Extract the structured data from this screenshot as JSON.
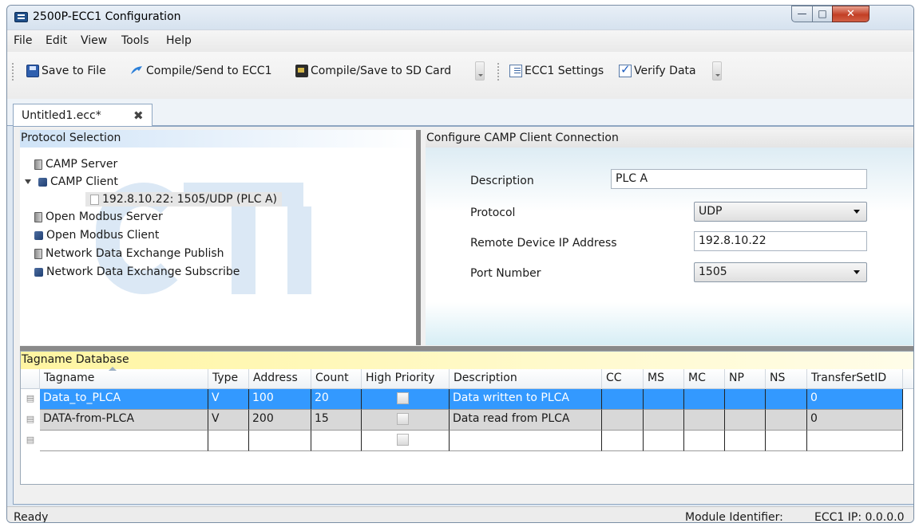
{
  "window": {
    "title": "2500P-ECC1 Configuration"
  },
  "menu": [
    "File",
    "Edit",
    "View",
    "Tools",
    "Help"
  ],
  "toolbar": {
    "save_file": "Save to File",
    "compile_send": "Compile/Send to ECC1",
    "compile_sd": "Compile/Save to SD Card",
    "ecc1_settings": "ECC1 Settings",
    "verify_data": "Verify Data"
  },
  "document_tab": {
    "label": "Untitled1.ecc*"
  },
  "protocol_pane": {
    "header": "Protocol Selection",
    "items": [
      "CAMP Server",
      "CAMP Client",
      "192.8.10.22: 1505/UDP (PLC A)",
      "Open Modbus Server",
      "Open Modbus Client",
      "Network Data Exchange Publish",
      "Network Data Exchange Subscribe"
    ]
  },
  "config_pane": {
    "header": "Configure CAMP Client Connection",
    "description_label": "Description",
    "description_value": "PLC A",
    "protocol_label": "Protocol",
    "protocol_value": "UDP",
    "ip_label": "Remote Device IP Address",
    "ip_value": "192.8.10.22",
    "port_label": "Port Number",
    "port_value": "1505"
  },
  "tag_db": {
    "header": "Tagname Database",
    "columns": [
      "Tagname",
      "Type",
      "Address",
      "Count",
      "High Priority",
      "Description",
      "CC",
      "MS",
      "MC",
      "NP",
      "NS",
      "TransferSetID"
    ],
    "rows": [
      [
        "Data_to_PLCA",
        "V",
        "100",
        "20",
        "",
        "Data written to PLCA",
        "",
        "",
        "",
        "",
        "",
        "0"
      ],
      [
        "DATA-from-PLCA",
        "V",
        "200",
        "15",
        "",
        "Data read from PLCA",
        "",
        "",
        "",
        "",
        "",
        "0"
      ],
      [
        "",
        "",
        "",
        "",
        "",
        "",
        "",
        "",
        "",
        "",
        "",
        ""
      ]
    ]
  },
  "status": {
    "left": "Ready",
    "module_label": "Module Identifier:",
    "ip_label": "ECC1 IP: 0.0.0.0"
  }
}
